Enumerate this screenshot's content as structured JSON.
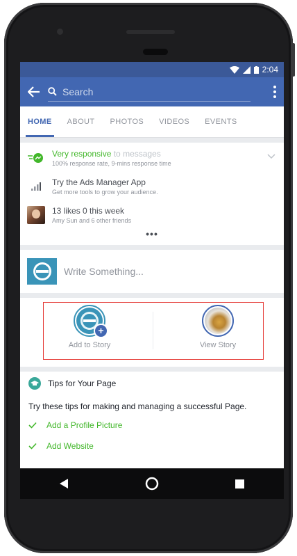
{
  "status_bar": {
    "time": "2:04"
  },
  "app_bar": {
    "search_placeholder": "Search",
    "back_icon": "arrow-left-icon",
    "more_icon": "kebab-menu-icon"
  },
  "tabs": [
    {
      "label": "HOME",
      "active": true
    },
    {
      "label": "ABOUT",
      "active": false
    },
    {
      "label": "PHOTOS",
      "active": false
    },
    {
      "label": "VIDEOS",
      "active": false
    },
    {
      "label": "EVENTS",
      "active": false
    }
  ],
  "info_rows": {
    "responsive": {
      "title_highlight": "Very responsive",
      "title_rest": " to messages",
      "subtitle": "100% response rate, 9-mins response time",
      "icon": "messenger-icon"
    },
    "ads": {
      "title": "Try the Ads Manager App",
      "subtitle": "Get more tools to grow your audience.",
      "icon": "bar-chart-icon"
    },
    "likes": {
      "title": "13 likes 0 this week",
      "subtitle": "Amy Sun and 6 other friends",
      "icon": "friend-avatar"
    },
    "more": "•••"
  },
  "composer": {
    "placeholder": "Write Something..."
  },
  "stories": {
    "add_label": "Add to Story",
    "view_label": "View Story"
  },
  "tips": {
    "title": "Tips for Your Page",
    "description": "Try these tips for making and managing a successful Page.",
    "items": [
      "Add a Profile Picture",
      "Add Website"
    ]
  },
  "colors": {
    "facebook_blue": "#4267b2",
    "status_blue": "#3b5998",
    "green": "#42b72a",
    "highlight_red": "#e53935"
  }
}
